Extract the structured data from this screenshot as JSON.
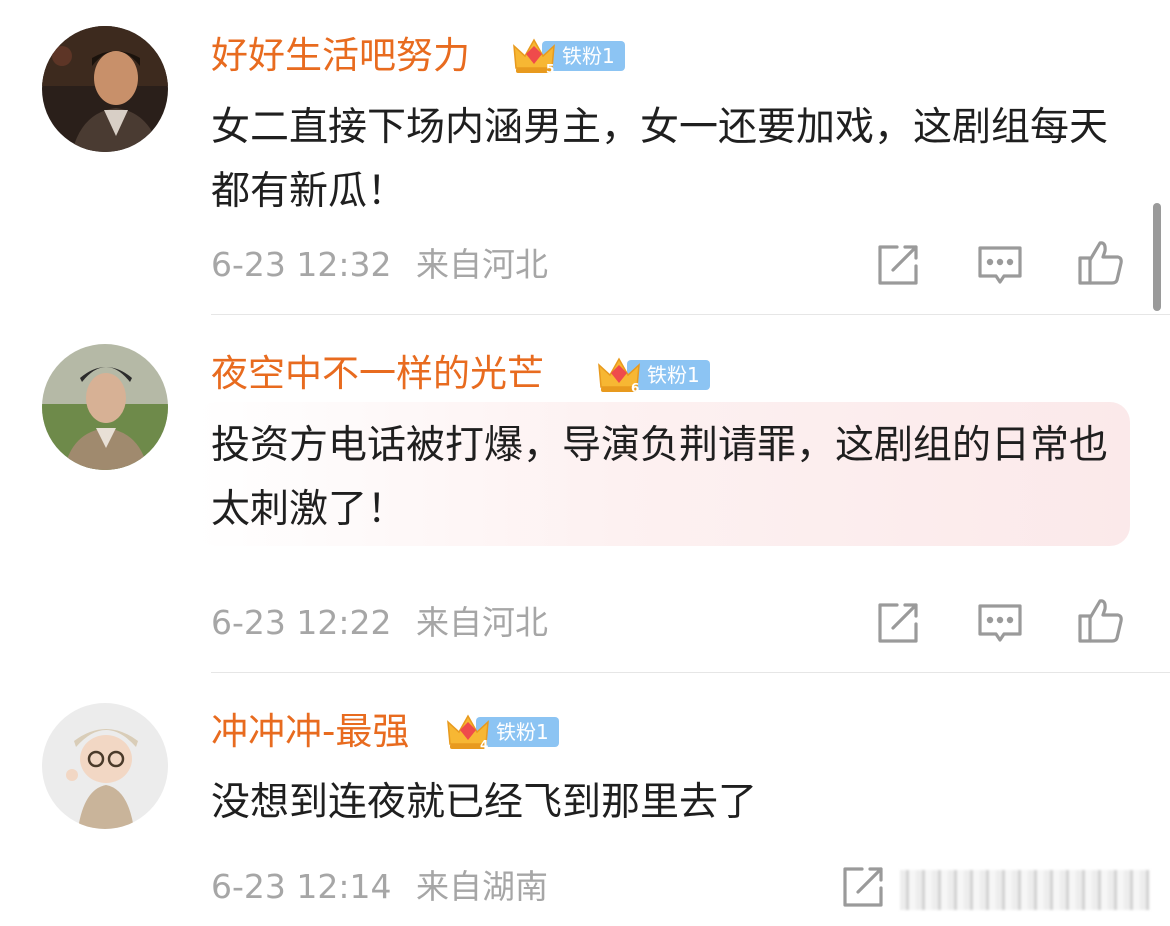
{
  "comments": [
    {
      "username": "好好生活吧努力",
      "badge_level": "5",
      "badge_label": "铁粉1",
      "text": "女二直接下场内涵男主，女一还要加戏，这剧组每天都有新瓜！",
      "time": "6-23 12:32",
      "location": "来自河北"
    },
    {
      "username": "夜空中不一样的光芒",
      "badge_level": "6",
      "badge_label": "铁粉1",
      "text": "投资方电话被打爆，导演负荆请罪，这剧组的日常也太刺激了！",
      "time": "6-23 12:22",
      "location": "来自河北"
    },
    {
      "username": "冲冲冲-最强",
      "badge_level": "4",
      "badge_label": "铁粉1",
      "text": "没想到连夜就已经飞到那里去了",
      "time": "6-23 12:14",
      "location": "来自湖南"
    }
  ],
  "colors": {
    "username": "#e86b1f",
    "badge_bg": "#8cc4f3",
    "meta": "#a6a6a6",
    "text": "#1f1f1f"
  },
  "icons": [
    "repost-icon",
    "comment-icon",
    "like-icon"
  ]
}
